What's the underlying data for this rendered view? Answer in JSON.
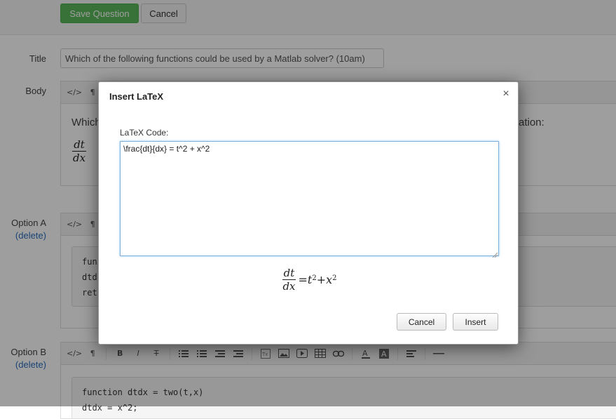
{
  "toolbar": {
    "save_label": "Save Question",
    "cancel_label": "Cancel"
  },
  "form": {
    "title_label": "Title",
    "title_value": "Which of the following functions could be used by a Matlab solver? (10am)",
    "body_label": "Body",
    "body_text_start": "Which",
    "body_text_end": "ation:",
    "option_a_label": "Option A",
    "option_a_delete": "(delete)",
    "option_a_code": [
      "fun",
      "dtd",
      "ret"
    ],
    "option_b_label": "Option B",
    "option_b_delete": "(delete)",
    "option_b_code": [
      "function dtdx = two(t,x)",
      "dtdx = x^2;"
    ]
  },
  "editor_toolbar": {
    "icons": [
      "code-view-icon",
      "paragraph-icon",
      "bold-icon",
      "italic-icon",
      "strikethrough-icon",
      "unordered-list-icon",
      "ordered-list-icon",
      "outdent-icon",
      "indent-icon",
      "latex-icon",
      "image-icon",
      "video-icon",
      "table-icon",
      "link-icon",
      "font-color-icon",
      "background-color-icon",
      "align-icon",
      "horizontal-rule-icon"
    ],
    "code_view": "</>",
    "paragraph": "¶",
    "bold": "B",
    "italic": "I",
    "strike": "T"
  },
  "modal": {
    "title": "Insert LaTeX",
    "close": "×",
    "code_label": "LaTeX Code:",
    "latex_code": "\\frac{dt}{dx} = t^2 + x^2",
    "preview": {
      "numerator": "dt",
      "denominator": "dx",
      "rhs_a": "t",
      "rhs_b": "x",
      "exp": "2",
      "eq": "=",
      "plus": "+"
    },
    "cancel_label": "Cancel",
    "insert_label": "Insert"
  }
}
